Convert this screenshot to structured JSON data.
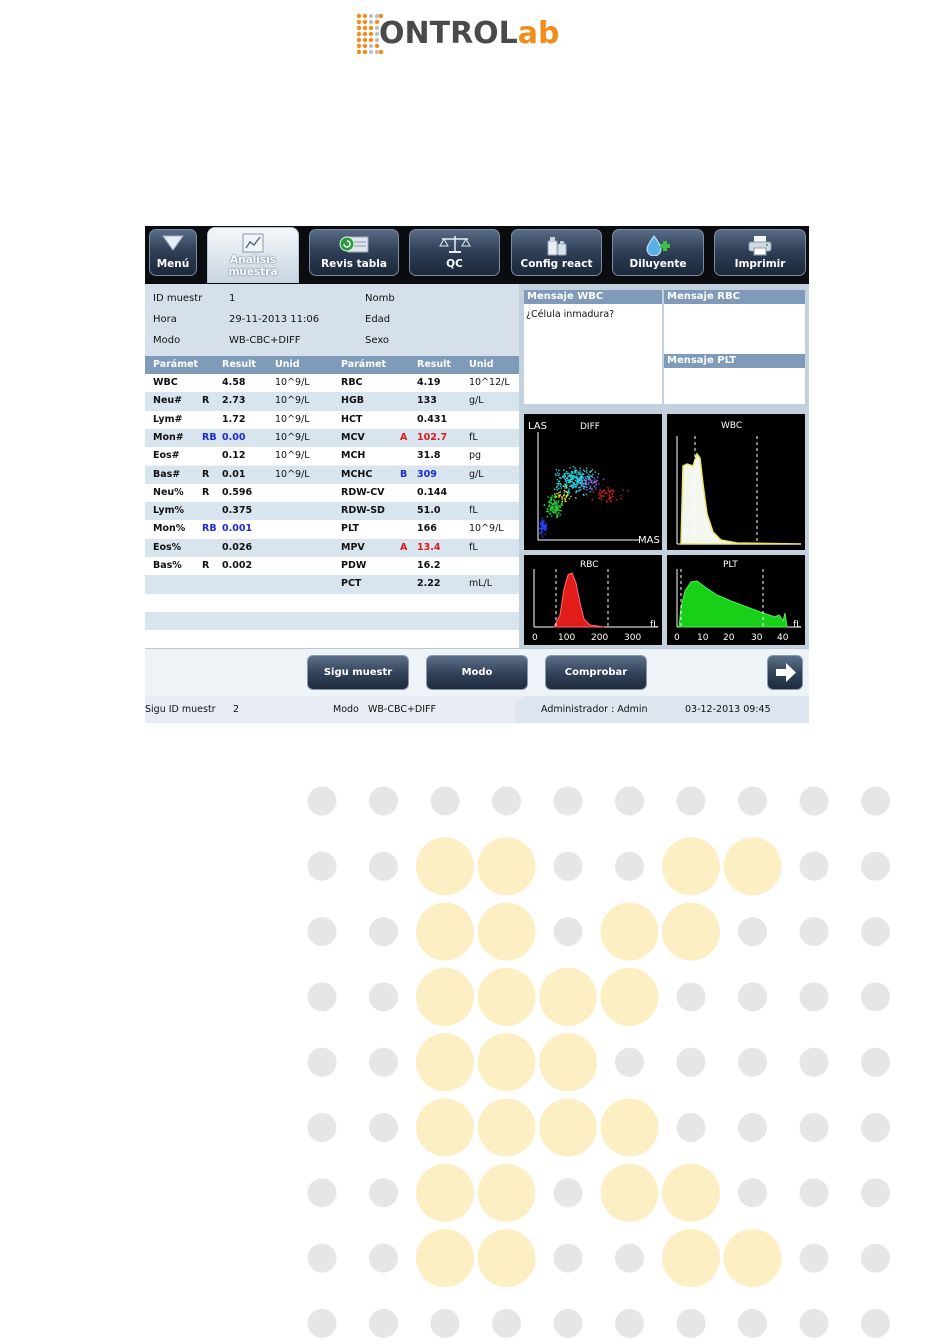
{
  "logo": {
    "part1": "ONTROL",
    "part2": "ab"
  },
  "toolbar": {
    "items": [
      {
        "label": "Menú"
      },
      {
        "label": "Analisis muestra"
      },
      {
        "label": "Revis tabla"
      },
      {
        "label": "QC"
      },
      {
        "label": "Config react"
      },
      {
        "label": "Diluyente"
      },
      {
        "label": "Imprimir"
      }
    ]
  },
  "info": {
    "id_label": "ID muestr",
    "id_value": "1",
    "hora_label": "Hora",
    "hora_value": "29-11-2013 11:06",
    "modo_label": "Modo",
    "modo_value": "WB-CBC+DIFF",
    "nomb_label": "Nomb",
    "edad_label": "Edad",
    "sexo_label": "Sexo"
  },
  "table": {
    "headers": {
      "param": "Parámet",
      "result": "Result",
      "unit": "Unid"
    },
    "left": [
      {
        "name": "WBC",
        "flag": "",
        "value": "4.58",
        "unit": "10^9/L"
      },
      {
        "name": "Neu#",
        "flag": "R",
        "value": "2.73",
        "unit": "10^9/L"
      },
      {
        "name": "Lym#",
        "flag": "",
        "value": "1.72",
        "unit": "10^9/L"
      },
      {
        "name": "Mon#",
        "flag": "RB",
        "value": "0.00",
        "unit": "10^9/L"
      },
      {
        "name": "Eos#",
        "flag": "",
        "value": "0.12",
        "unit": "10^9/L"
      },
      {
        "name": "Bas#",
        "flag": "R",
        "value": "0.01",
        "unit": "10^9/L"
      },
      {
        "name": "Neu%",
        "flag": "R",
        "value": "0.596",
        "unit": ""
      },
      {
        "name": "Lym%",
        "flag": "",
        "value": "0.375",
        "unit": ""
      },
      {
        "name": "Mon%",
        "flag": "RB",
        "value": "0.001",
        "unit": ""
      },
      {
        "name": "Eos%",
        "flag": "",
        "value": "0.026",
        "unit": ""
      },
      {
        "name": "Bas%",
        "flag": "R",
        "value": "0.002",
        "unit": ""
      }
    ],
    "right": [
      {
        "name": "RBC",
        "flag": "",
        "value": "4.19",
        "unit": "10^12/L"
      },
      {
        "name": "HGB",
        "flag": "",
        "value": "133",
        "unit": "g/L"
      },
      {
        "name": "HCT",
        "flag": "",
        "value": "0.431",
        "unit": ""
      },
      {
        "name": "MCV",
        "flag": "A",
        "value": "102.7",
        "unit": "fL"
      },
      {
        "name": "MCH",
        "flag": "",
        "value": "31.8",
        "unit": "pg"
      },
      {
        "name": "MCHC",
        "flag": "B",
        "value": "309",
        "unit": "g/L"
      },
      {
        "name": "RDW-CV",
        "flag": "",
        "value": "0.144",
        "unit": ""
      },
      {
        "name": "RDW-SD",
        "flag": "",
        "value": "51.0",
        "unit": "fL"
      },
      {
        "name": "PLT",
        "flag": "",
        "value": "166",
        "unit": "10^9/L"
      },
      {
        "name": "MPV",
        "flag": "A",
        "value": "13.4",
        "unit": "fL"
      },
      {
        "name": "PDW",
        "flag": "",
        "value": "16.2",
        "unit": ""
      },
      {
        "name": "PCT",
        "flag": "",
        "value": "2.22",
        "unit": "mL/L"
      }
    ]
  },
  "messages": {
    "wbc_title": "Mensaje WBC",
    "wbc_text": "¿Célula inmadura?",
    "rbc_title": "Mensaje RBC",
    "plt_title": "Mensaje PLT"
  },
  "graphs": {
    "diff_title": "DIFF",
    "diff_y": "LAS",
    "diff_x": "MAS",
    "wbc_title": "WBC",
    "rbc_title": "RBC",
    "rbc_unit": "fL",
    "rbc_ticks": [
      "0",
      "100",
      "200",
      "300"
    ],
    "plt_title": "PLT",
    "plt_unit": "fL",
    "plt_ticks": [
      "0",
      "10",
      "20",
      "30",
      "40"
    ]
  },
  "actions": {
    "next_sample": "Sigu muestr",
    "mode": "Modo",
    "check": "Comprobar"
  },
  "status": {
    "next_id_label": "Sigu ID muestr",
    "next_id_value": "2",
    "mode_label": "Modo",
    "mode_value": "WB-CBC+DIFF",
    "user": "Administrador : Admin",
    "datetime": "03-12-2013 09:45"
  }
}
